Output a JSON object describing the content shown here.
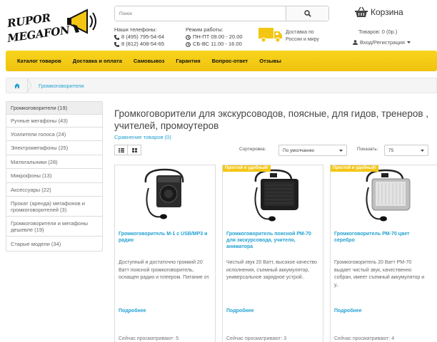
{
  "header": {
    "logo_line1": "RUPOR",
    "logo_line2": "MEGAFON",
    "search_placeholder": "Поиск",
    "phones_label": "Наши телефоны:",
    "phone1": "8 (495) 795-54-64",
    "phone2": "8 (812) 408-54-65",
    "hours_label": "Режим работы:",
    "hours1": "ПН-ПТ 09.00 - 20.00",
    "hours2": "СБ-ВС 11.00 - 16.00",
    "delivery_text": "Доставка по России и миру",
    "cart_label": "Корзина",
    "cart_count": "Товаров: 0 (0р.)",
    "login_label": "Вход/Регистрация"
  },
  "nav": {
    "items": [
      "Каталог товаров",
      "Доставка и оплата",
      "Самовывоз",
      "Гарантия",
      "Вопрос-ответ",
      "Отзывы"
    ]
  },
  "breadcrumb": {
    "current": "Громкоговорители"
  },
  "sidebar": {
    "items": [
      "Громкоговорители (19)",
      "Ручные мегафоны (43)",
      "Усилители голоса (24)",
      "Электромегафоны (25)",
      "Матюгальники (28)",
      "Микрофоны (13)",
      "Аксессуары (22)",
      "Прокат (аренда) мегафонов и громкоговорителей (3)",
      "Громкоговорители и мегафоны дешевле (19)",
      "Старые модели (34)"
    ]
  },
  "main": {
    "title": "Громкоговорители для экскурсоводов, поясные, для гидов, тренеров , учителей, промоутеров",
    "compare": "Сравнение товаров (0)",
    "sort_label": "Сортировка:",
    "sort_value": "По умолчанию",
    "show_label": "Показать:",
    "show_value": "75"
  },
  "products": [
    {
      "badge": "",
      "name": "Громкоговоритель М-1 с USB/MP3 и радио",
      "desc": "Доступный и достаточно громкий 20 Ватт поясной громкоговоритель, оснащен радио и плеером. Питание от.",
      "more": "Подробнее",
      "watch": "Сейчас просматривают: 5"
    },
    {
      "badge": "Простой и удобный!",
      "name": "Громкоговоритель поясной РМ-70 для экскурсовода, учителя, аниматора",
      "desc": "Чистый звук 20 Ватт, высокое качество исполнения, съемный аккумулятор, универсальное зарядное устрой..",
      "more": "Подробнее",
      "watch": "Сейчас просматривают: 3"
    },
    {
      "badge": "Простой и удобный!",
      "name": "Громкоговоритель РМ-70 цвет серебро",
      "desc": "Громкоговоритель 20 Ватт РМ-70 выдает чистый звук, качественно собран, имеет съемный аккумулятор и у..",
      "more": "Подробнее",
      "watch": "Сейчас просматривают: 4"
    }
  ],
  "colors": {
    "accent": "#f3c613",
    "link": "#23a1d1"
  }
}
